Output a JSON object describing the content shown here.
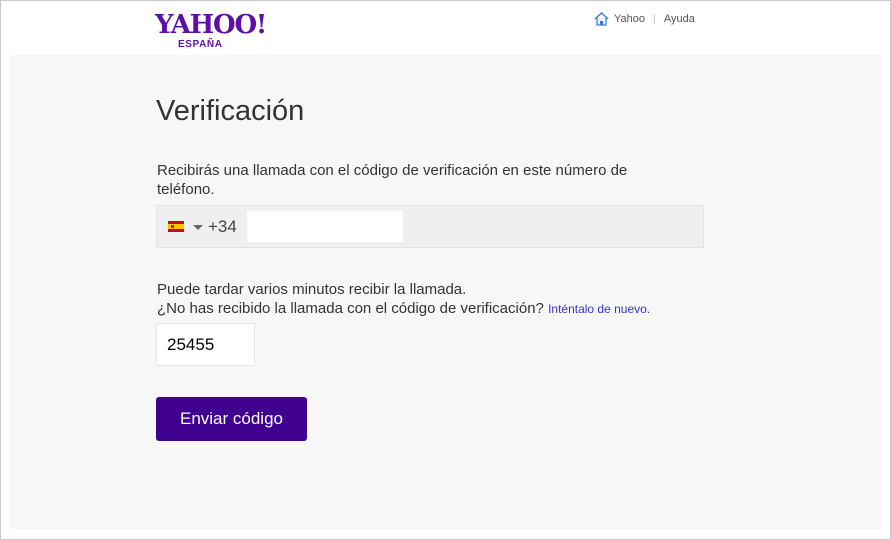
{
  "header": {
    "logo_text": "YAHOO!",
    "logo_sub": "ESPAÑA",
    "nav": {
      "home_label": "Yahoo",
      "help_label": "Ayuda"
    }
  },
  "main": {
    "title": "Verificación",
    "description": "Recibirás una llamada con el código de verificación en este número de teléfono.",
    "phone": {
      "country_code": "+34",
      "country_flag_icon": "spain-flag-icon",
      "number_value": ""
    },
    "wait_text": "Puede tardar varios minutos recibir la llamada.",
    "not_received_text": "¿No has recibido la llamada con el código de verificación?",
    "retry_link": "Inténtalo de nuevo.",
    "verification_code_value": "25455",
    "send_button": "Enviar código"
  },
  "colors": {
    "brand": "#5f0fa8",
    "button": "#400090",
    "link": "#3333cc",
    "panel": "#f7f7f7"
  }
}
